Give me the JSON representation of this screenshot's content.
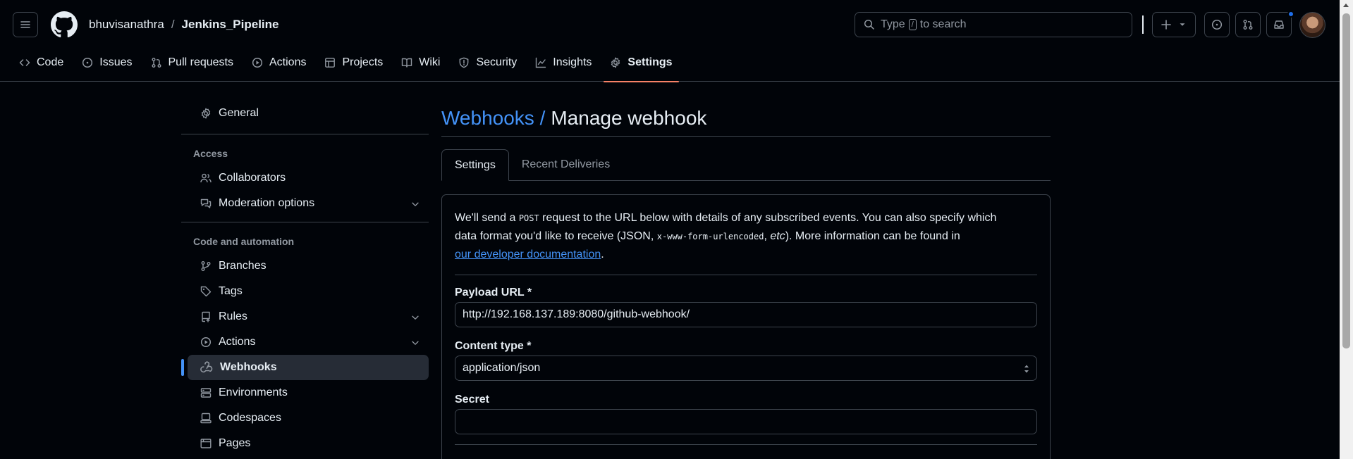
{
  "header": {
    "owner": "bhuvisanathra",
    "separator": "/",
    "repo": "Jenkins_Pipeline",
    "search": {
      "before": "Type",
      "key": "/",
      "after": "to search"
    }
  },
  "nav": [
    {
      "label": "Code",
      "icon": "code-icon"
    },
    {
      "label": "Issues",
      "icon": "issue-icon"
    },
    {
      "label": "Pull requests",
      "icon": "pull-request-icon"
    },
    {
      "label": "Actions",
      "icon": "play-icon"
    },
    {
      "label": "Projects",
      "icon": "table-icon"
    },
    {
      "label": "Wiki",
      "icon": "book-icon"
    },
    {
      "label": "Security",
      "icon": "shield-icon"
    },
    {
      "label": "Insights",
      "icon": "graph-icon"
    },
    {
      "label": "Settings",
      "icon": "gear-icon",
      "active": true
    }
  ],
  "sidebar": {
    "general": "General",
    "access_heading": "Access",
    "collaborators": "Collaborators",
    "moderation": "Moderation options",
    "code_heading": "Code and automation",
    "branches": "Branches",
    "tags": "Tags",
    "rules": "Rules",
    "actions": "Actions",
    "webhooks": "Webhooks",
    "environments": "Environments",
    "codespaces": "Codespaces",
    "pages": "Pages"
  },
  "main": {
    "title_link": "Webhooks /",
    "title_rest": "Manage webhook",
    "tabs": [
      "Settings",
      "Recent Deliveries"
    ],
    "intro": {
      "p1": "We'll send a ",
      "post": "POST",
      "p2": " request to the URL below with details of any subscribed events. You can also specify which data format you'd like to receive (JSON, ",
      "urlencoded": "x-www-form-urlencoded",
      "p3": ", ",
      "etc": "etc",
      "p4": "). More information can be found in ",
      "link": "our developer documentation",
      "p5": "."
    },
    "payload_label": "Payload URL *",
    "payload_value": "http://192.168.137.189:8080/github-webhook/",
    "content_type_label": "Content type *",
    "content_type_value": "application/json",
    "secret_label": "Secret",
    "secret_value": ""
  },
  "colors": {
    "background": "#010409",
    "border": "#3d444d",
    "link": "#4493f8",
    "active_underline": "#f78166"
  }
}
